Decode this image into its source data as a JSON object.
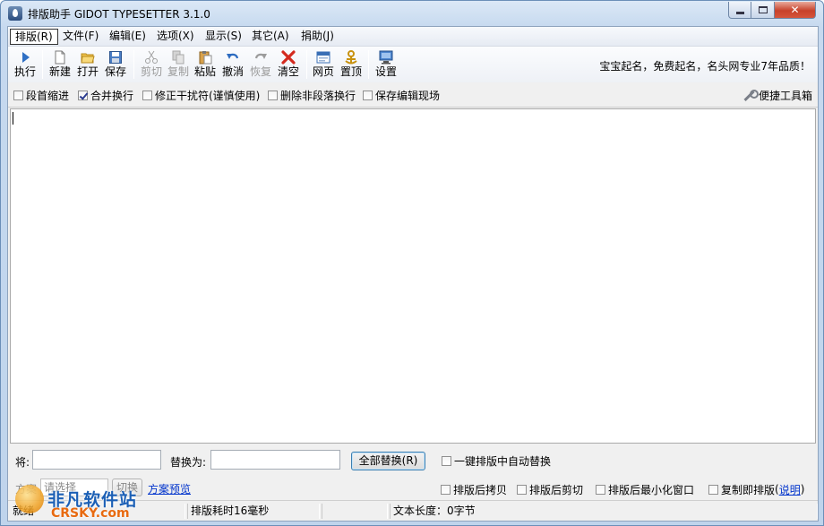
{
  "window": {
    "title": "排版助手 GIDOT TYPESETTER 3.1.0"
  },
  "menu": [
    {
      "label": "排版(R)",
      "active": true
    },
    {
      "label": "文件(F)"
    },
    {
      "label": "编辑(E)"
    },
    {
      "label": "选项(X)"
    },
    {
      "label": "显示(S)"
    },
    {
      "label": "其它(A)"
    },
    {
      "label": "捐助(J)"
    }
  ],
  "toolbar": {
    "buttons": [
      {
        "label": "执行",
        "icon": "play-icon",
        "enabled": true
      },
      {
        "label": "新建",
        "icon": "new-file-icon",
        "enabled": true
      },
      {
        "label": "打开",
        "icon": "open-folder-icon",
        "enabled": true
      },
      {
        "label": "保存",
        "icon": "save-icon",
        "enabled": true
      },
      {
        "label": "剪切",
        "icon": "cut-icon",
        "enabled": false
      },
      {
        "label": "复制",
        "icon": "copy-icon",
        "enabled": false
      },
      {
        "label": "粘贴",
        "icon": "paste-icon",
        "enabled": true
      },
      {
        "label": "撤消",
        "icon": "undo-icon",
        "enabled": true
      },
      {
        "label": "恢复",
        "icon": "redo-icon",
        "enabled": false
      },
      {
        "label": "清空",
        "icon": "clear-icon",
        "enabled": true
      },
      {
        "label": "网页",
        "icon": "webpage-icon",
        "enabled": true
      },
      {
        "label": "置顶",
        "icon": "pin-top-icon",
        "enabled": true
      },
      {
        "label": "设置",
        "icon": "settings-icon",
        "enabled": true
      }
    ],
    "slogan": "宝宝起名，免费起名，名头网专业7年品质！"
  },
  "options": {
    "items": [
      {
        "label": "段首缩进",
        "checked": false
      },
      {
        "label": "合并换行",
        "checked": true
      },
      {
        "label": "修正干扰符(谨慎使用)",
        "checked": false
      },
      {
        "label": "删除非段落换行",
        "checked": false
      },
      {
        "label": "保存编辑现场",
        "checked": false
      }
    ],
    "toolbox_label": "便捷工具箱"
  },
  "editor": {
    "content": ""
  },
  "replace": {
    "from_label": "将:",
    "from_value": "",
    "to_label": "替换为:",
    "to_value": "",
    "replace_all_label": "全部替换(R)",
    "auto_replace_label": "一键排版中自动替换",
    "auto_replace_checked": false
  },
  "scheme": {
    "label": "方案",
    "select_placeholder": "请选择",
    "switch_label": "切换",
    "preview_link": "方案预览"
  },
  "post_options": [
    {
      "label": "排版后拷贝",
      "checked": false
    },
    {
      "label": "排版后剪切",
      "checked": false
    },
    {
      "label": "排版后最小化窗口",
      "checked": false
    },
    {
      "label": "复制即排版",
      "checked": false
    }
  ],
  "post_help_open": "(",
  "post_help_link": "说明",
  "post_help_close": ")",
  "status": {
    "ready": "就绪",
    "elapsed": "排版耗时16毫秒",
    "length": "文本长度：0字节"
  },
  "watermark": {
    "name": "非凡软件站",
    "site": "CRSKY.com"
  }
}
